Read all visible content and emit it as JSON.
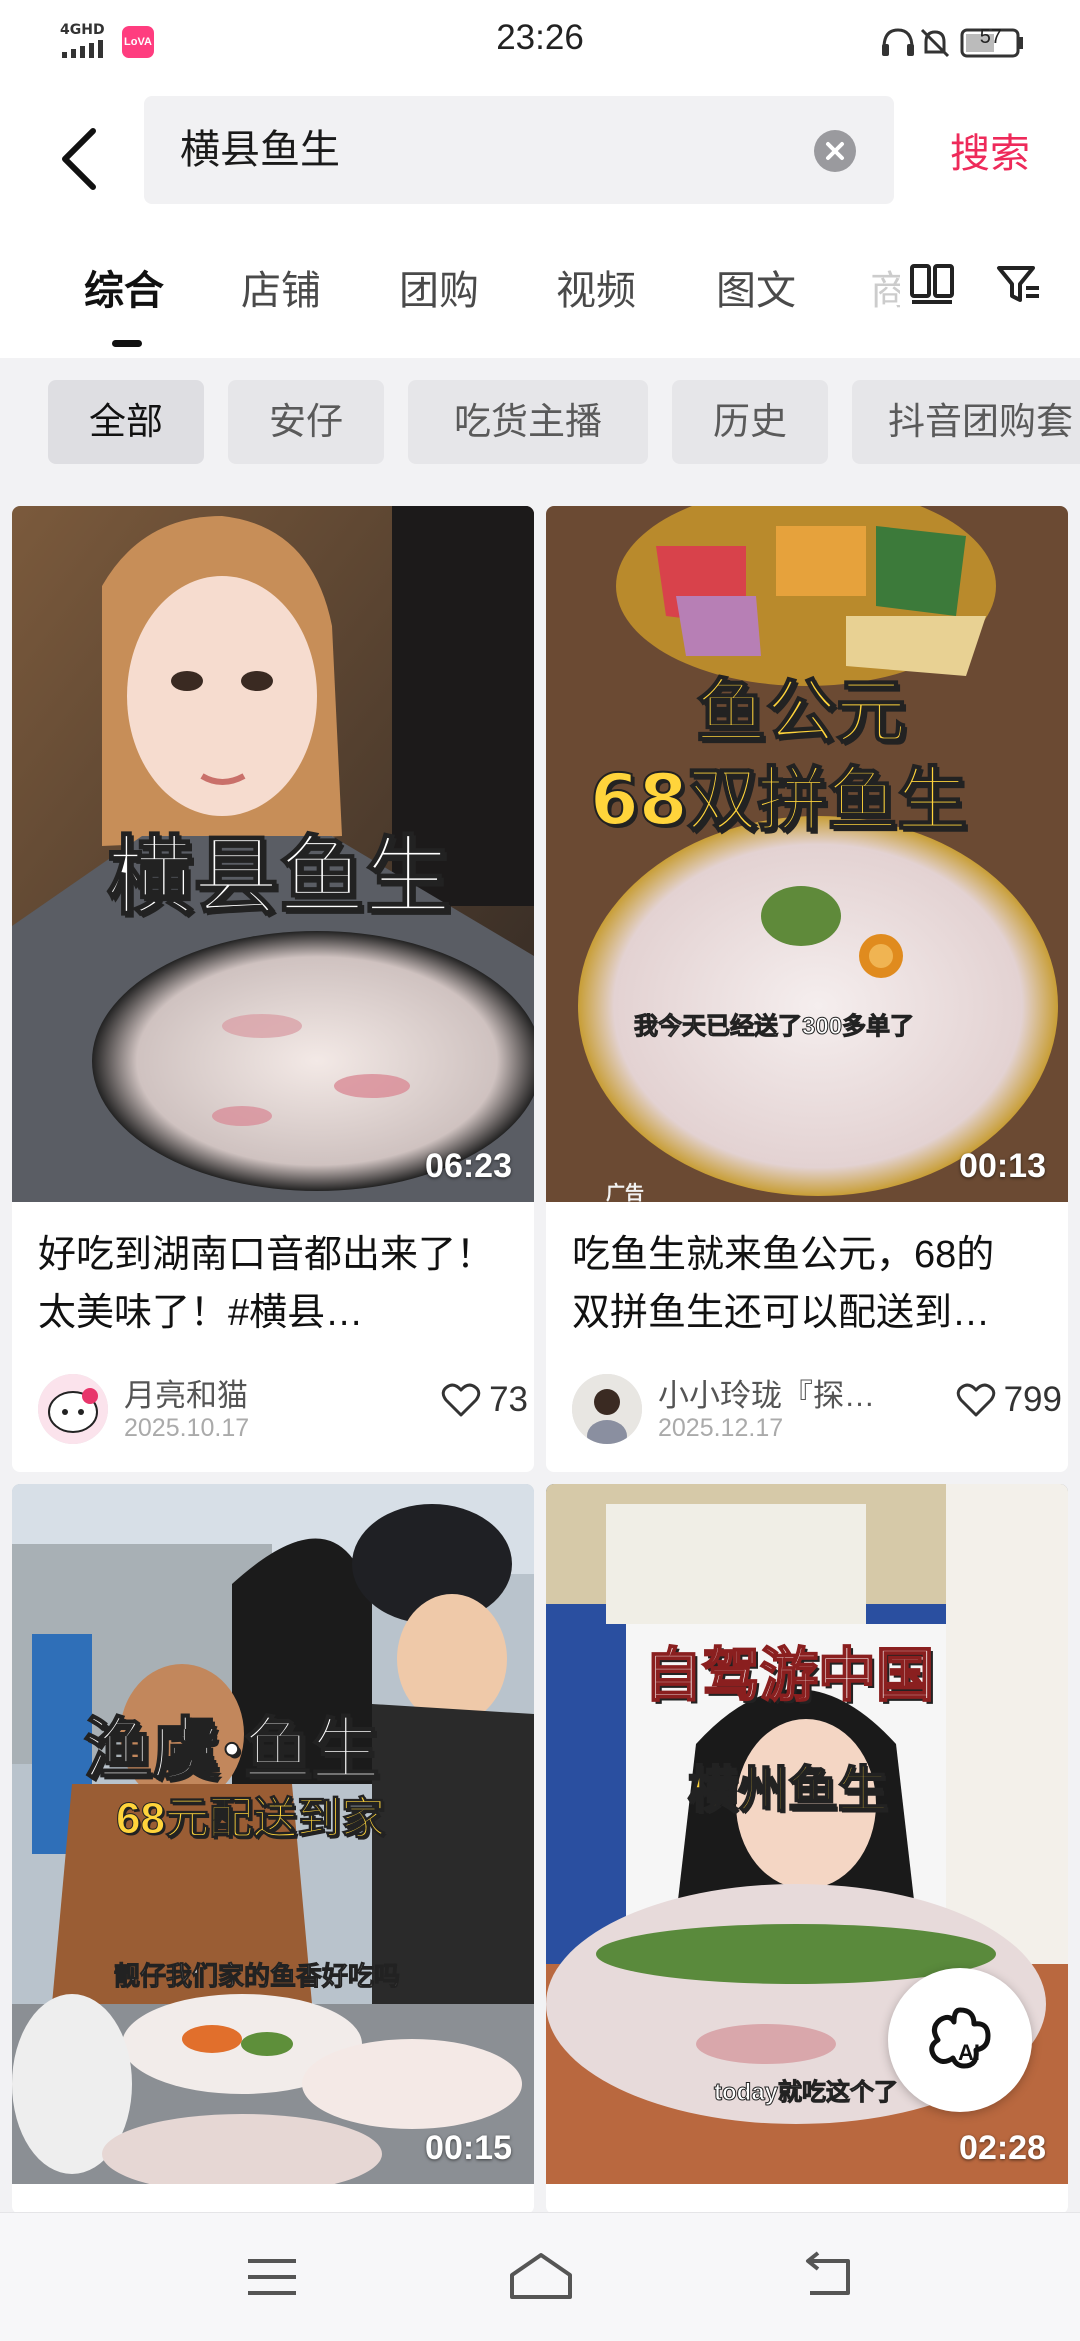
{
  "status_bar": {
    "time": "23:26",
    "network": "4GHD",
    "battery": "57",
    "app_badge": "LoVA"
  },
  "search": {
    "query": "横县鱼生",
    "button_label": "搜索"
  },
  "tabs": [
    {
      "label": "综合",
      "active": true
    },
    {
      "label": "店铺"
    },
    {
      "label": "团购"
    },
    {
      "label": "视频"
    },
    {
      "label": "图文"
    },
    {
      "label": "商"
    }
  ],
  "chips": [
    "全部",
    "安仔",
    "吃货主播",
    "历史",
    "抖音团购套"
  ],
  "results": [
    {
      "overlay_title": "横县鱼生",
      "duration": "06:23",
      "title": "好吃到湖南口音都出来了！太美味了！#横县…",
      "author": "月亮和猫",
      "date": "2025.10.17",
      "likes": "73"
    },
    {
      "overlay_line1": "鱼公元",
      "overlay_line2": "68双拼鱼生",
      "overlay_sub": "我今天已经送了300多单了",
      "ad_label": "广告",
      "duration": "00:13",
      "title": "吃鱼生就来鱼公元，68的双拼鱼生还可以配送到…",
      "author": "小小玲珑『探…",
      "date": "2025.12.17",
      "likes": "799"
    },
    {
      "overlay_line1": "渔虞·鱼生",
      "overlay_line2": "68元配送到家",
      "overlay_sub": "靓仔我们家的鱼香好吃吗",
      "duration": "00:15"
    },
    {
      "overlay_line1": "自驾游中国",
      "overlay_line2": "横州鱼生",
      "overlay_sub": "today就吃这个了",
      "duration": "02:28"
    }
  ],
  "ai_button_label": "AI",
  "colors": {
    "accent": "#ee2a5a",
    "background": "#f2f2f4"
  }
}
